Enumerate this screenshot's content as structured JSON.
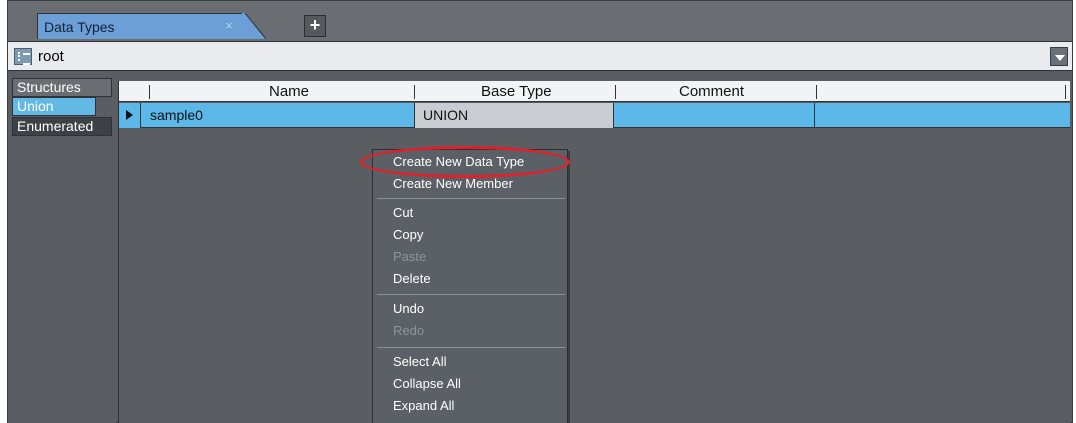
{
  "tabs": [
    {
      "label": "Data Types",
      "close": "×"
    }
  ],
  "add_tab_label": "+",
  "path": {
    "value": "root"
  },
  "categories": [
    {
      "label": "Structures"
    },
    {
      "label": "Union"
    },
    {
      "label": "Enumerated"
    }
  ],
  "grid": {
    "headers": [
      "Name",
      "Base Type",
      "Comment"
    ],
    "rows": [
      {
        "name": "sample0",
        "base_type": "UNION",
        "comment": ""
      }
    ]
  },
  "context_menu": {
    "items": [
      {
        "label": "Create New Data Type",
        "enabled": true
      },
      {
        "label": "Create New Member",
        "enabled": true
      },
      {
        "label": "Cut",
        "enabled": true
      },
      {
        "label": "Copy",
        "enabled": true
      },
      {
        "label": "Paste",
        "enabled": false
      },
      {
        "label": "Delete",
        "enabled": true
      },
      {
        "label": "Undo",
        "enabled": true
      },
      {
        "label": "Redo",
        "enabled": false
      },
      {
        "label": "Select All",
        "enabled": true
      },
      {
        "label": "Collapse All",
        "enabled": true
      },
      {
        "label": "Expand All",
        "enabled": true
      }
    ]
  },
  "colors": {
    "tab_active": "#6c9fd6",
    "selected_row": "#5bb8e8",
    "annotation_ring": "#e0212a"
  }
}
